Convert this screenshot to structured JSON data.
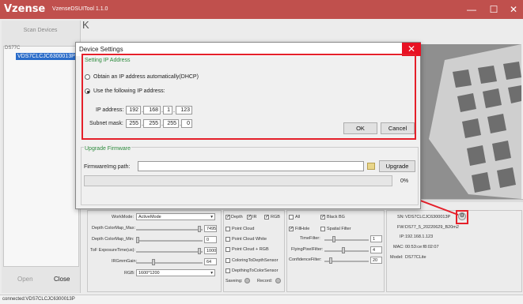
{
  "main_window": {
    "brand": "Vzense",
    "version_title": "VzenseDSUITool 1.1.0",
    "minimize": "—",
    "maximize": "☐",
    "close": "✕",
    "collapse_glyph": "K"
  },
  "left_panel": {
    "scan_label": "Scan Devices",
    "tree_root": "DS77C",
    "device_item": "VDS7CLCJC6300013P",
    "open_label": "Open",
    "close_label": "Close"
  },
  "status_bar": {
    "text": "connected:VDS7CLCJC6300013P"
  },
  "controls": {
    "work_mode_label": "WorkMode:",
    "work_mode_value": "ActiveMode",
    "depth_colormap_max_label": "Depth ColorMap_Max:",
    "depth_colormap_max_value": "7495",
    "depth_colormap_min_label": "Depth ColorMap_Min:",
    "depth_colormap_min_value": "0",
    "tof_exposure_label": "ToF ExposureTime(us):",
    "tof_exposure_value": "1000",
    "ir_gmm_gain_label": "IRGmmGain:",
    "ir_gmm_gain_value": "64",
    "rgb_label": "RGB:",
    "rgb_value": "1600*1200",
    "depth_cb": "Depth",
    "ir_cb": "IR",
    "rgb_cb": "RGB",
    "point_cloud": "Point Cloud",
    "point_cloud_white": "Point Cloud White",
    "point_cloud_rgb": "Point Cloud + RGB",
    "coloring_to_depth": "ColoringToDepthSensor",
    "depthing_to_color": "DepthingToColorSensor",
    "saving_label": "Saveing:",
    "record_label": "Record:",
    "all_cb": "All",
    "black_bg_cb": "Black BG",
    "fillhole_cb": "FillHole",
    "spatial_filter_cb": "Spatial Filter",
    "time_filter_label": "TimeFilter:",
    "time_filter_value": "1",
    "flying_pixel_label": "FlyingPixelFilter:",
    "flying_pixel_value": "4",
    "confidence_label": "ConfidenceFilter:",
    "confidence_value": "20",
    "sn_label": "SN:",
    "sn_value": "VDS7CLCJC6300013P",
    "fw_label": "FW:",
    "fw_value": "DS77_5_20220629_B20m2",
    "ip_label": "IP:",
    "ip_value": "192.168.1.123",
    "mac_label": "MAC:",
    "mac_value": "00:53:ce:f8:02:07",
    "model_label": "Model:",
    "model_value": "DS77CLite"
  },
  "dialog": {
    "title": "Device Settings",
    "close": "✕",
    "ip_group_title": "Setting IP Address",
    "dhcp_option": "Obtain an IP address automatically(DHCP)",
    "static_option": "Use the following IP address:",
    "ip_address_label": "IP address:",
    "ip_octets": [
      "192",
      "168",
      "1",
      "123"
    ],
    "subnet_label": "Subnet mask:",
    "subnet_octets": [
      "255",
      "255",
      "255",
      "0"
    ],
    "ok_label": "OK",
    "cancel_label": "Cancel",
    "upgrade_group_title": "Upgrade Firmware",
    "firmware_path_label": "FirmwareImg path:",
    "firmware_path_value": "",
    "upgrade_label": "Upgrade",
    "progress_text": "0%",
    "progress_fraction": 0
  },
  "colors": {
    "accent_red": "#c0504d",
    "highlight_red": "#e5202a",
    "group_title_green": "#2e8b3e",
    "selection_blue": "#2a6cc9"
  }
}
